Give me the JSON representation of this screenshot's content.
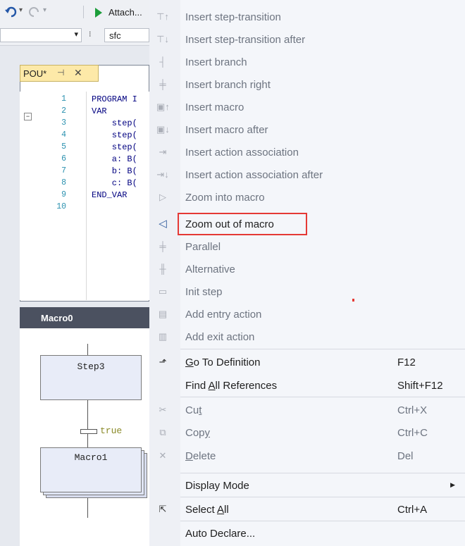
{
  "toolbar": {
    "attach_label": "Attach...",
    "combo_value": "sfc"
  },
  "editor": {
    "tab_label": "POU*",
    "line_numbers": [
      "1",
      "2",
      "3",
      "4",
      "5",
      "6",
      "7",
      "8",
      "9",
      "10"
    ],
    "code_lines": [
      "PROGRAM I",
      "VAR",
      "    step(",
      "    step(",
      "    step(",
      "    a: B(",
      "    b: B(",
      "    c: B(",
      "END_VAR",
      ""
    ]
  },
  "macro_panel": {
    "title": "Macro0",
    "step_name": "Step3",
    "transition_condition": "true",
    "macro_name": "Macro1"
  },
  "menu": {
    "items": [
      {
        "icon": "insert-step-transition-icon",
        "label": "Insert step-transition",
        "enabled": false
      },
      {
        "icon": "insert-step-transition-after-icon",
        "label": "Insert step-transition after",
        "enabled": false
      },
      {
        "icon": "insert-branch-icon",
        "label": "Insert branch",
        "enabled": false
      },
      {
        "icon": "insert-branch-right-icon",
        "label": "Insert branch right",
        "enabled": false
      },
      {
        "icon": "insert-macro-icon",
        "label": "Insert macro",
        "enabled": false
      },
      {
        "icon": "insert-macro-after-icon",
        "label": "Insert macro after",
        "enabled": false
      },
      {
        "icon": "insert-action-association-icon",
        "label": "Insert action association",
        "enabled": false
      },
      {
        "icon": "insert-action-association-after-icon",
        "label": "Insert action association after",
        "enabled": false
      },
      {
        "icon": "zoom-into-macro-icon",
        "label": "Zoom into macro",
        "enabled": false
      },
      {
        "icon": "zoom-out-of-macro-icon",
        "label": "Zoom out of macro",
        "enabled": true,
        "highlighted": true
      },
      {
        "icon": "parallel-icon",
        "label": "Parallel",
        "enabled": false
      },
      {
        "icon": "alternative-icon",
        "label": "Alternative",
        "enabled": false
      },
      {
        "icon": "init-step-icon",
        "label": "Init step",
        "enabled": false
      },
      {
        "icon": "add-entry-action-icon",
        "label": "Add entry action",
        "enabled": false
      },
      {
        "icon": "add-exit-action-icon",
        "label": "Add exit action",
        "enabled": false
      },
      {
        "icon": "go-to-definition-icon",
        "label_pre": "",
        "label_key": "G",
        "label_post": "o To Definition",
        "shortcut": "F12",
        "enabled": true
      },
      {
        "label_pre": "Find ",
        "label_key": "A",
        "label_post": "ll References",
        "shortcut": "Shift+F12",
        "enabled": true
      },
      {
        "icon": "cut-icon",
        "label_pre": "Cu",
        "label_key": "t",
        "label_post": "",
        "shortcut": "Ctrl+X",
        "enabled": false
      },
      {
        "icon": "copy-icon",
        "label_pre": "Cop",
        "label_key": "y",
        "label_post": "",
        "shortcut": "Ctrl+C",
        "enabled": false
      },
      {
        "icon": "delete-icon",
        "label_pre": "",
        "label_key": "D",
        "label_post": "elete",
        "shortcut": "Del",
        "enabled": false
      },
      {
        "label": "Display Mode",
        "submenu": true,
        "enabled": true
      },
      {
        "icon": "select-all-icon",
        "label_pre": "Select ",
        "label_key": "A",
        "label_post": "ll",
        "shortcut": "Ctrl+A",
        "enabled": true
      },
      {
        "label": "Auto Declare...",
        "enabled": true
      }
    ]
  },
  "colors": {
    "highlight_border": "#e53935",
    "macro_header": "#4b5160",
    "tab_active": "#fde9a8"
  }
}
